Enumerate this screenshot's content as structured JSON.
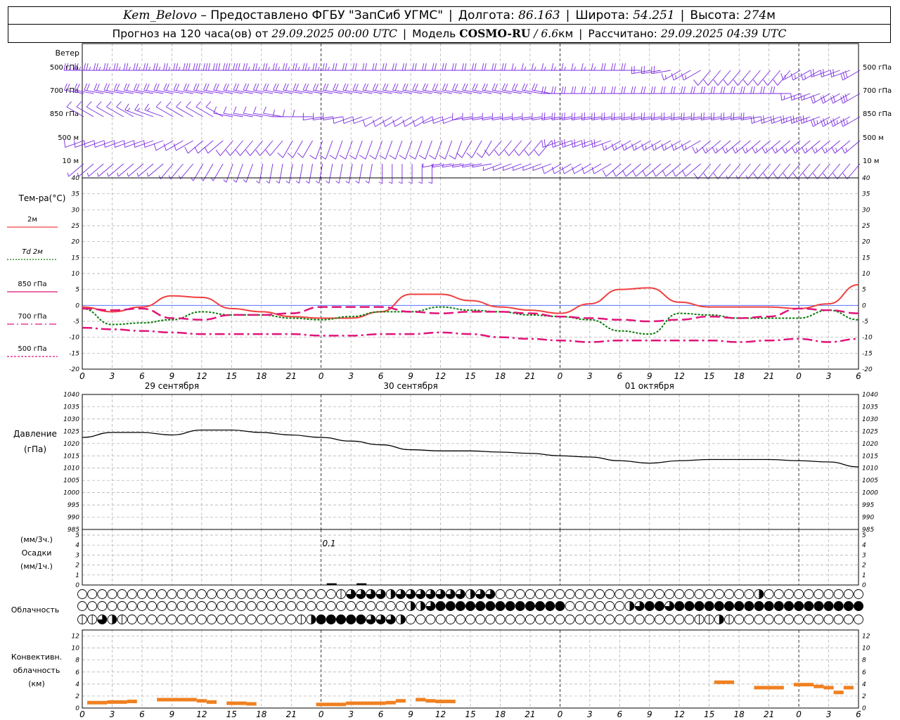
{
  "header": {
    "station": "Kem_Belovo",
    "provider": "– Предоставлено ФГБУ \"ЗапСиб УГМС\"",
    "lon_label": "Долгота:",
    "lon_value": "86.163",
    "lat_label": "Широта:",
    "lat_value": "54.251",
    "alt_label": "Высота:",
    "alt_value": "274",
    "alt_unit": "м",
    "forecast_label": "Прогноз на 120 часа(ов) от",
    "forecast_time": "29.09.2025 00:00 UTC",
    "model_label": "Модель",
    "model_name": "COSMO-RU",
    "model_res": "/ 6.6",
    "model_res_unit": "км",
    "calc_label": "Рассчитано:",
    "calc_time": "29.09.2025 04:39 UTC"
  },
  "labels": {
    "wind": "Ветер",
    "wind_levels": [
      "500 гПа",
      "700 гПа",
      "850 гПа",
      "500 м",
      "10  м"
    ],
    "temp_title": "Тем-ра(°C)",
    "temp_legend": [
      "2м",
      "Td 2м",
      "850 гПа",
      "700 гПа",
      "500 гПа"
    ],
    "pressure_title": "Давление",
    "pressure_unit": "(гПа)",
    "precip_unit3": "(мм/3ч.)",
    "precip_title": "Осадки",
    "precip_unit1": "(мм/1ч.)",
    "precip_annotation": "0.1",
    "cloud_title": "Облачность",
    "conv_title": [
      "Конвективн.",
      "облачность",
      "(км)"
    ],
    "dates": [
      "29 сентября",
      "30 сентября",
      "01 октября"
    ]
  },
  "colors": {
    "t2m": "#f04040",
    "td2m": "#0a7a0a",
    "t850": "#e0147a",
    "t700": "#e0147a",
    "t500": "#e0147a",
    "wind": "#7a2be0",
    "pressure": "#000000",
    "convective": "#f08020",
    "zero_line": "#4060ff"
  },
  "chart_data": {
    "type": "line",
    "x_hour_ticks": [
      "0",
      "3",
      "6",
      "9",
      "12",
      "15",
      "18",
      "21",
      "0",
      "3",
      "6",
      "9",
      "12",
      "15",
      "18",
      "21",
      "0",
      "3",
      "6",
      "9",
      "12",
      "15",
      "18",
      "21",
      "0",
      "3",
      "6"
    ],
    "temperature": {
      "ylim": [
        -20,
        40
      ],
      "yticks": [
        -20,
        -15,
        -10,
        -5,
        0,
        5,
        10,
        15,
        20,
        25,
        30,
        35,
        40
      ],
      "x": [
        0,
        3,
        6,
        9,
        12,
        15,
        18,
        21,
        24,
        27,
        30,
        33,
        36,
        39,
        42,
        45,
        48,
        51,
        54,
        57,
        60,
        63,
        66,
        69,
        72,
        75,
        78
      ],
      "series": [
        {
          "name": "2м",
          "values": [
            -0.5,
            -2,
            -0.5,
            3,
            2.5,
            -1,
            -2,
            -3.5,
            -4,
            -4,
            -2,
            3.5,
            3.5,
            1.5,
            -0.5,
            -1.5,
            -2.5,
            0.5,
            5,
            5.5,
            1,
            -0.5,
            -0.5,
            -0.5,
            -1,
            0.5,
            6.5
          ]
        },
        {
          "name": "Td 2м",
          "values": [
            -1,
            -6,
            -5.5,
            -4.5,
            -2,
            -3,
            -3,
            -4,
            -4.5,
            -3.5,
            -2,
            -2,
            -0.5,
            -1.5,
            -2,
            -3,
            -3.5,
            -4.5,
            -8,
            -9,
            -2.5,
            -3,
            -4,
            -4,
            -4,
            -1.5,
            -4.5
          ]
        },
        {
          "name": "850 гПа",
          "values": [
            -1,
            -1.5,
            -1,
            -4,
            -4.5,
            -3,
            -3,
            -2.5,
            -0.5,
            -0.5,
            -0.5,
            -2,
            -2.5,
            -2,
            -2,
            -2.5,
            -3.5,
            -4,
            -4.5,
            -5,
            -4.5,
            -3.5,
            -4,
            -3.5,
            -1,
            -1.5,
            -2.5
          ]
        },
        {
          "name": "700 гПа",
          "values": [
            -7,
            -7.5,
            -8,
            -8.5,
            -9,
            -9,
            -9,
            -9,
            -9.5,
            -9.5,
            -9,
            -9,
            -8.5,
            -9,
            -10,
            -10.5,
            -11,
            -11.5,
            -11,
            -11,
            -11,
            -11,
            -11.5,
            -11,
            -10.5,
            -11.5,
            -10.5
          ]
        }
      ]
    },
    "pressure": {
      "ylim": [
        985,
        1040
      ],
      "yticks": [
        985,
        990,
        995,
        1000,
        1005,
        1010,
        1015,
        1020,
        1025,
        1030,
        1035,
        1040
      ],
      "x": [
        0,
        3,
        6,
        9,
        12,
        15,
        18,
        21,
        24,
        27,
        30,
        33,
        36,
        39,
        42,
        45,
        48,
        51,
        54,
        57,
        60,
        63,
        66,
        69,
        72,
        75,
        78
      ],
      "values": [
        1022.5,
        1024.5,
        1024.5,
        1023.5,
        1025.5,
        1025.5,
        1024.5,
        1023.5,
        1022.5,
        1021,
        1019.5,
        1017.5,
        1017,
        1017,
        1016.5,
        1016,
        1015,
        1014.5,
        1013,
        1012,
        1013,
        1013.5,
        1013.5,
        1013.5,
        1013,
        1012.5,
        1010.5
      ]
    },
    "precipitation": {
      "ylim": [
        0,
        5
      ],
      "yticks": [
        0,
        1,
        2,
        3,
        4,
        5
      ],
      "x": [
        24,
        27
      ],
      "values": [
        0.1,
        0.1
      ]
    },
    "cloud_cover": {
      "high": [
        0,
        0,
        0,
        0,
        0,
        0,
        0,
        0,
        0,
        0,
        0,
        0,
        0,
        0,
        0,
        0,
        0,
        0,
        0,
        0,
        0,
        0,
        0,
        0,
        0,
        0,
        0,
        0,
        0,
        0,
        0,
        0,
        0,
        0,
        0,
        0,
        0,
        0,
        0,
        0,
        0,
        0,
        0,
        0,
        0,
        0,
        0,
        0,
        0,
        0,
        0,
        0,
        0,
        0,
        0,
        0,
        0,
        0,
        2,
        4,
        6,
        6,
        6,
        6,
        6,
        6,
        6,
        6,
        6,
        4,
        6,
        6,
        6,
        6,
        6,
        6,
        6,
        6,
        6,
        4,
        6,
        6,
        6,
        6,
        6,
        6,
        6,
        4,
        6,
        6,
        6,
        6,
        0,
        0,
        0,
        0,
        0,
        0,
        0,
        0,
        0,
        0,
        0,
        0,
        0,
        0,
        0,
        0,
        0,
        0,
        0,
        0,
        0,
        0,
        0,
        0,
        0,
        0,
        0,
        0,
        0,
        0,
        0,
        0,
        0,
        0,
        0,
        0,
        0,
        0,
        0,
        0,
        0,
        0,
        0,
        0,
        0,
        0,
        0,
        0,
        0,
        0,
        0,
        0,
        0,
        0,
        0,
        0,
        0,
        0,
        2,
        4,
        4,
        0,
        0,
        0,
        0,
        0,
        0,
        0,
        0,
        0,
        0,
        0,
        0,
        0,
        0,
        0,
        0,
        0,
        0,
        0,
        0,
        0,
        0
      ],
      "mid": [
        0,
        0,
        0,
        0,
        0,
        0,
        0,
        0,
        0,
        0,
        0,
        0,
        0,
        0,
        0,
        0,
        0,
        0,
        0,
        0,
        0,
        0,
        0,
        0,
        0,
        0,
        0,
        0,
        0,
        0,
        0,
        0,
        0,
        0,
        0,
        0,
        0,
        0,
        0,
        0,
        0,
        0,
        0,
        0,
        0,
        0,
        0,
        0,
        0,
        0,
        0,
        0,
        0,
        0,
        0,
        0,
        0,
        0,
        0,
        0,
        0,
        0,
        0,
        0,
        0,
        0,
        0,
        0,
        0,
        0,
        0,
        0,
        2,
        4,
        8,
        4,
        8,
        6,
        6,
        8,
        8,
        8,
        8,
        8,
        8,
        8,
        8,
        8,
        8,
        8,
        8,
        8,
        8,
        8,
        8,
        8,
        8,
        8,
        8,
        8,
        8,
        8,
        8,
        6,
        8,
        8,
        8,
        8,
        0,
        0,
        0,
        0,
        0,
        0,
        0,
        0,
        0,
        0,
        0,
        0,
        0,
        4,
        4,
        6,
        8,
        8,
        8,
        8,
        8,
        8,
        6,
        8,
        8,
        8,
        4,
        8,
        6,
        8,
        8,
        8,
        8,
        8,
        8,
        8,
        8,
        8,
        8,
        8,
        8,
        8,
        8,
        8,
        8,
        8,
        8,
        8,
        8,
        8,
        8,
        8,
        8,
        8,
        8,
        8,
        8,
        8,
        8,
        8,
        8,
        8,
        8,
        8,
        8
      ],
      "low": [
        2,
        2,
        2,
        6,
        6,
        2,
        2,
        4,
        2,
        2,
        2,
        0,
        0,
        0,
        0,
        0,
        0,
        0,
        0,
        0,
        0,
        0,
        0,
        0,
        0,
        0,
        0,
        0,
        0,
        0,
        0,
        0,
        0,
        0,
        0,
        0,
        0,
        0,
        0,
        0,
        0,
        0,
        0,
        0,
        0,
        0,
        0,
        0,
        2,
        2,
        4,
        4,
        8,
        8,
        8,
        8,
        8,
        8,
        8,
        8,
        8,
        8,
        8,
        8,
        8,
        6,
        6,
        6,
        6,
        6,
        6,
        4,
        6,
        0,
        0,
        0,
        0,
        0,
        0,
        0,
        0,
        0,
        0,
        0,
        0,
        0,
        0,
        0,
        0,
        0,
        0,
        0,
        0,
        0,
        0,
        0,
        0,
        0,
        0,
        0,
        0,
        0,
        0,
        0,
        0,
        0,
        0,
        0,
        0,
        0,
        0,
        0,
        0,
        0,
        0,
        0,
        0,
        0,
        0,
        0,
        0,
        0,
        0,
        0,
        0,
        0,
        0,
        0,
        0,
        0,
        0,
        0,
        0,
        0,
        0,
        0,
        0,
        2,
        2,
        2,
        4,
        2,
        2,
        4,
        2,
        2,
        2,
        0,
        0,
        0,
        0,
        0,
        0,
        0,
        0,
        0,
        0,
        0,
        0,
        0,
        0,
        0,
        0,
        0,
        0,
        0,
        0,
        0,
        0,
        0,
        0,
        0,
        0,
        0,
        0
      ]
    },
    "convective": {
      "ylim": [
        0,
        13
      ],
      "yticks": [
        0,
        2,
        4,
        6,
        8,
        10,
        12
      ],
      "segments": [
        {
          "x0": 0.5,
          "x1": 2.5,
          "h": 0.9
        },
        {
          "x0": 2.5,
          "x1": 4.5,
          "h": 1.0
        },
        {
          "x0": 4.5,
          "x1": 5.5,
          "h": 1.1
        },
        {
          "x0": 7.5,
          "x1": 11.5,
          "h": 1.4
        },
        {
          "x0": 11.5,
          "x1": 12.5,
          "h": 1.2
        },
        {
          "x0": 12.5,
          "x1": 13.5,
          "h": 1.0
        },
        {
          "x0": 14.5,
          "x1": 16.5,
          "h": 0.8
        },
        {
          "x0": 16.5,
          "x1": 17.5,
          "h": 0.7
        },
        {
          "x0": 23.5,
          "x1": 26.5,
          "h": 0.6
        },
        {
          "x0": 26.5,
          "x1": 30.5,
          "h": 0.8
        },
        {
          "x0": 30.5,
          "x1": 31.5,
          "h": 0.9
        },
        {
          "x0": 31.5,
          "x1": 32.5,
          "h": 1.2
        },
        {
          "x0": 33.5,
          "x1": 34.5,
          "h": 1.4
        },
        {
          "x0": 34.5,
          "x1": 35.5,
          "h": 1.2
        },
        {
          "x0": 35.5,
          "x1": 37.5,
          "h": 1.1
        },
        {
          "x0": 63.5,
          "x1": 65.5,
          "h": 4.3
        },
        {
          "x0": 67.5,
          "x1": 70.5,
          "h": 3.4
        },
        {
          "x0": 71.5,
          "x1": 73.5,
          "h": 3.9
        },
        {
          "x0": 73.5,
          "x1": 74.5,
          "h": 3.6
        },
        {
          "x0": 74.5,
          "x1": 75.5,
          "h": 3.4
        },
        {
          "x0": 75.5,
          "x1": 76.5,
          "h": 2.6
        },
        {
          "x0": 76.5,
          "x1": 77.5,
          "h": 3.4
        }
      ]
    },
    "wind": {
      "levels": [
        "500 гПа",
        "700 гПа",
        "850 гПа",
        "500 м",
        "10 м"
      ],
      "speed": [
        [
          20,
          20,
          22,
          22,
          24,
          24,
          22,
          20,
          20,
          18,
          18,
          16,
          16,
          16,
          16,
          14,
          14,
          14,
          16,
          18,
          14,
          8,
          8,
          10,
          14,
          18,
          24
        ],
        [
          16,
          16,
          16,
          16,
          18,
          18,
          18,
          18,
          18,
          18,
          18,
          18,
          18,
          16,
          16,
          16,
          16,
          16,
          16,
          16,
          16,
          16,
          16,
          16,
          14,
          16,
          24
        ],
        [
          8,
          8,
          14,
          10,
          10,
          10,
          8,
          8,
          8,
          8,
          8,
          8,
          8,
          8,
          8,
          10,
          16,
          16,
          18,
          18,
          18,
          18,
          18,
          18,
          20,
          20,
          22
        ],
        [
          8,
          8,
          10,
          8,
          8,
          8,
          8,
          8,
          8,
          8,
          8,
          8,
          8,
          8,
          8,
          8,
          18,
          16,
          14,
          14,
          14,
          12,
          12,
          12,
          12,
          14,
          14
        ],
        [
          4,
          4,
          4,
          4,
          4,
          4,
          4,
          4,
          4,
          4,
          4,
          4,
          6,
          6,
          6,
          6,
          8,
          8,
          8,
          8,
          8,
          8,
          6,
          8,
          8,
          8,
          10
        ]
      ],
      "dir": [
        [
          270,
          270,
          270,
          270,
          270,
          270,
          270,
          270,
          270,
          270,
          270,
          270,
          270,
          270,
          270,
          270,
          270,
          270,
          270,
          260,
          240,
          220,
          220,
          220,
          240,
          250,
          240
        ],
        [
          280,
          280,
          280,
          280,
          280,
          280,
          280,
          280,
          280,
          280,
          280,
          280,
          280,
          280,
          280,
          280,
          270,
          270,
          270,
          270,
          270,
          270,
          270,
          270,
          250,
          240,
          240
        ],
        [
          300,
          300,
          290,
          300,
          300,
          280,
          280,
          270,
          260,
          250,
          240,
          240,
          250,
          260,
          260,
          260,
          260,
          260,
          260,
          260,
          260,
          260,
          260,
          250,
          250,
          240,
          240
        ],
        [
          250,
          250,
          250,
          240,
          230,
          220,
          220,
          210,
          200,
          200,
          200,
          200,
          200,
          210,
          220,
          220,
          250,
          250,
          240,
          240,
          240,
          230,
          230,
          230,
          230,
          230,
          230
        ],
        [
          230,
          230,
          230,
          220,
          210,
          200,
          190,
          190,
          190,
          190,
          180,
          180,
          260,
          260,
          250,
          250,
          240,
          240,
          230,
          230,
          230,
          220,
          220,
          220,
          220,
          220,
          220
        ]
      ]
    }
  }
}
